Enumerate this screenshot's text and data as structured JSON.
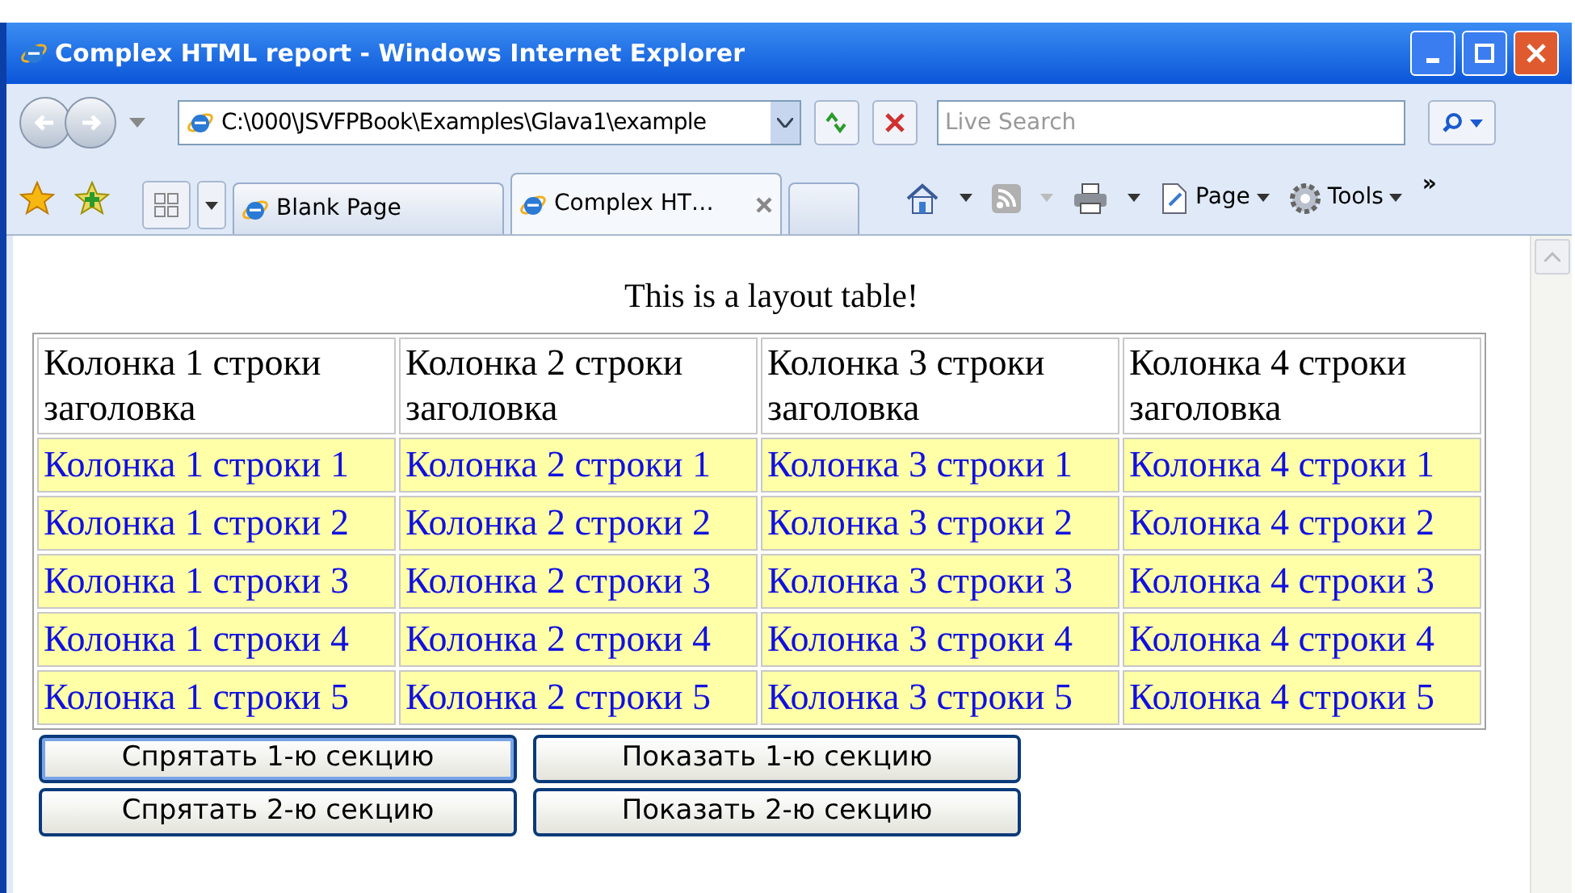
{
  "window": {
    "title": "Complex HTML report - Windows Internet Explorer"
  },
  "address_bar": {
    "value": "C:\\000\\JSVFPBook\\Examples\\Glava1\\example"
  },
  "search": {
    "placeholder": "Live Search"
  },
  "tabs": [
    {
      "label": "Blank Page",
      "selected": false
    },
    {
      "label": "Complex HT…",
      "selected": true
    }
  ],
  "toolbar": [
    {
      "label": "Page"
    },
    {
      "label": "Tools"
    }
  ],
  "toolbar_overflow": "»",
  "page": {
    "caption": "This is a layout table!",
    "table": {
      "columns": [
        "Колонка 1 строки заголовка",
        "Колонка 2 строки заголовка",
        "Колонка 3 строки заголовка",
        "Колонка 4 строки заголовка"
      ],
      "rows": [
        [
          "Колонка 1 строки 1",
          "Колонка 2 строки 1",
          "Колонка 3 строки 1",
          "Колонка 4 строки 1"
        ],
        [
          "Колонка 1 строки 2",
          "Колонка 2 строки 2",
          "Колонка 3 строки 2",
          "Колонка 4 строки 2"
        ],
        [
          "Колонка 1 строки 3",
          "Колонка 2 строки 3",
          "Колонка 3 строки 3",
          "Колонка 4 строки 3"
        ],
        [
          "Колонка 1 строки 4",
          "Колонка 2 строки 4",
          "Колонка 3 строки 4",
          "Колонка 4 строки 4"
        ],
        [
          "Колонка 1 строки 5",
          "Колонка 2 строки 5",
          "Колонка 3 строки 5",
          "Колонка 4 строки 5"
        ]
      ]
    },
    "buttons": [
      {
        "label": "Спрятать 1-ю секцию",
        "focused": true
      },
      {
        "label": "Показать 1-ю секцию",
        "focused": false
      },
      {
        "label": "Спрятать 2-ю секцию",
        "focused": false
      },
      {
        "label": "Показать 2-ю секцию",
        "focused": false
      }
    ]
  }
}
